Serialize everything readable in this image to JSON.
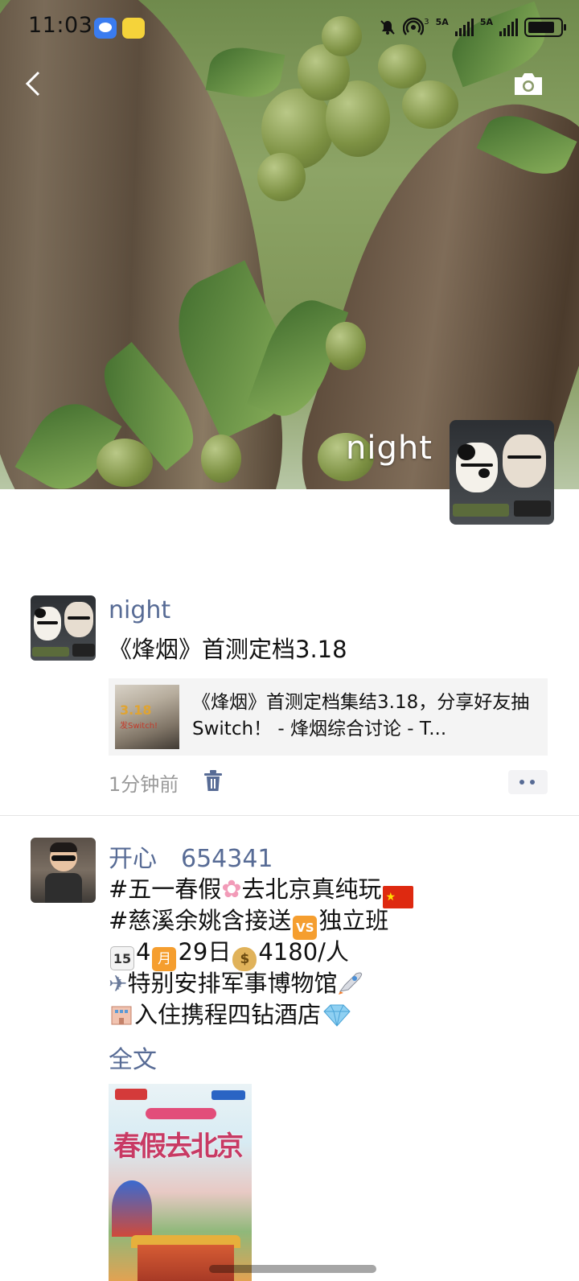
{
  "status_bar": {
    "time": "11:03",
    "network_1": "5A",
    "network_2": "5A",
    "hotspot_sup": "3"
  },
  "cover": {
    "owner_name": "night"
  },
  "posts": [
    {
      "author": "night",
      "text": "《烽烟》首测定档3.18",
      "link": {
        "thumb_text": "3.18",
        "thumb_sub": "发Switch!",
        "title": "《烽烟》首测定档集结3.18，分享好友抽Switch！ - 烽烟综合讨论 - T..."
      },
      "time_ago": "1分钟前"
    },
    {
      "author": "开心　654341",
      "lines": {
        "l1a": "#五一春假",
        "l1b": "去北京真纯玩",
        "l2a": "#慈溪余姚含接送",
        "l2b": "独立班",
        "l3a": "4",
        "l3b": "29日",
        "l3c": "4180/人",
        "l4": "特别安排军事博物馆",
        "l5": "入住携程四钻酒店"
      },
      "emoji": {
        "vs": "VS",
        "month": "月",
        "calendar_day": "15"
      },
      "full_text_label": "全文",
      "poster": {
        "headline": "春假去北京"
      }
    }
  ],
  "colors": {
    "link_blue": "#576b95",
    "meta_gray": "#9a9a9a",
    "card_bg": "#f4f4f4"
  }
}
